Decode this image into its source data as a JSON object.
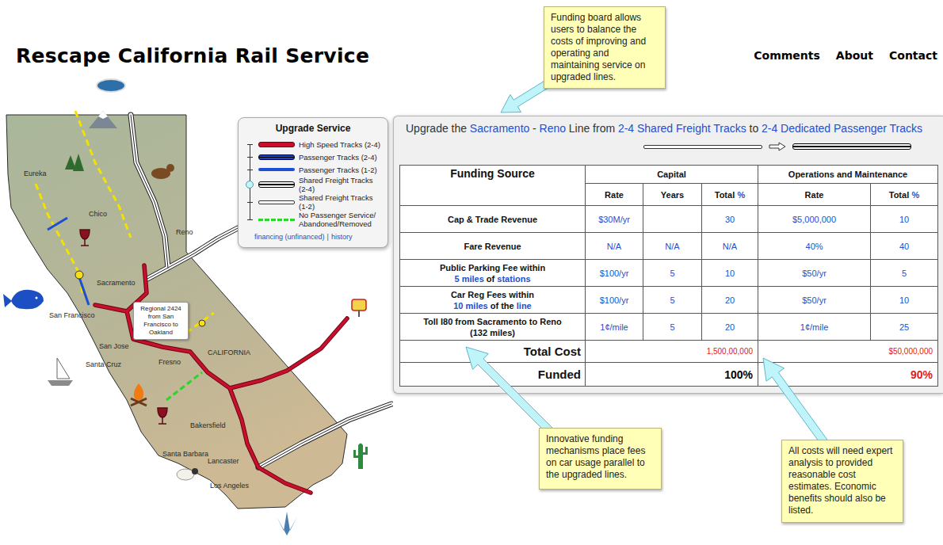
{
  "header": {
    "title": "Rescape California Rail Service",
    "nav": [
      "Comments",
      "About",
      "Contact"
    ]
  },
  "map": {
    "labels": [
      "Eureka",
      "Chico",
      "Reno",
      "Sacramento",
      "San Francisco",
      "San Jose",
      "Santa Cruz",
      "Fresno",
      "CALIFORNIA",
      "Bakersfield",
      "Lancaster",
      "Santa Barbara",
      "Los Angeles"
    ],
    "tooltip": "Regional 2424 from San Francisco to Oakland"
  },
  "legend": {
    "title": "Upgrade Service",
    "items": [
      {
        "label": "High Speed Tracks (2-4)",
        "kind": "high-speed",
        "selected": false
      },
      {
        "label": "Passenger Tracks (2-4)",
        "kind": "passenger-double",
        "selected": false
      },
      {
        "label": "Passenger Tracks (1-2)",
        "kind": "passenger-single",
        "selected": false
      },
      {
        "label": "Shared Freight Tracks (2-4)",
        "kind": "freight-double",
        "selected": true
      },
      {
        "label": "Shared Freight Tracks (1-2)",
        "kind": "freight-single",
        "selected": false
      },
      {
        "label": "No Passenger Service/ Abandoned/Removed",
        "kind": "none",
        "selected": false
      }
    ],
    "links": [
      "financing (unfinanced)",
      "history"
    ],
    "separator": "|"
  },
  "board": {
    "heading": [
      {
        "text": "Upgrade the",
        "link": false
      },
      {
        "text": "Sacramento",
        "link": true
      },
      {
        "text": "-",
        "link": false
      },
      {
        "text": "Reno",
        "link": true
      },
      {
        "text": "Line from",
        "link": false
      },
      {
        "text": "2-4 Shared Freight Tracks",
        "link": true
      },
      {
        "text": "to",
        "link": false
      },
      {
        "text": "2-4 Dedicated Passenger Tracks",
        "link": true
      }
    ],
    "transition": {
      "from": "freight-single",
      "to": "freight-double"
    },
    "table": {
      "source_header": "Funding Source",
      "groups": [
        {
          "label": "Capital",
          "columns": [
            {
              "label": "Rate",
              "unit": ""
            },
            {
              "label": "Years",
              "unit": ""
            },
            {
              "label": "Total",
              "unit": "%"
            }
          ]
        },
        {
          "label": "Operations and Maintenance",
          "columns": [
            {
              "label": "Rate",
              "unit": ""
            },
            {
              "label": "Total",
              "unit": "%"
            }
          ]
        }
      ],
      "rows": [
        {
          "source": [
            [
              {
                "text": "Cap & Trade Revenue",
                "link": false
              }
            ]
          ],
          "cells": [
            "$30M/yr",
            "",
            "30",
            "$5,000,000",
            "10"
          ]
        },
        {
          "source": [
            [
              {
                "text": "Fare Revenue",
                "link": false
              }
            ]
          ],
          "cells": [
            "N/A",
            "N/A",
            "N/A",
            "40%",
            "40"
          ]
        },
        {
          "source": [
            [
              {
                "text": "Public Parking Fee within",
                "link": false
              }
            ],
            [
              {
                "text": "5 miles",
                "link": true
              },
              {
                "text": "of",
                "link": false
              },
              {
                "text": "stations",
                "link": true
              }
            ]
          ],
          "cells": [
            "$100/yr",
            "5",
            "10",
            "$50/yr",
            "5"
          ]
        },
        {
          "source": [
            [
              {
                "text": "Car Reg Fees within",
                "link": false
              }
            ],
            [
              {
                "text": "10 miles",
                "link": true
              },
              {
                "text": "of the",
                "link": false
              },
              {
                "text": "line",
                "link": true
              }
            ]
          ],
          "cells": [
            "$100/yr",
            "5",
            "20",
            "$50/yr",
            "10"
          ]
        },
        {
          "source": [
            [
              {
                "text": "Toll I80 from Sacramento to Reno",
                "link": false
              }
            ],
            [
              {
                "text": "(132 miles)",
                "link": false
              }
            ]
          ],
          "cells": [
            "1¢/mile",
            "5",
            "20",
            "1¢/mile",
            "25"
          ]
        }
      ],
      "totals": [
        {
          "label": "Total Cost",
          "values": [
            {
              "text": "1,500,00,000",
              "color": "#e02020"
            },
            {
              "text": "$50,000,000",
              "color": "#e02020"
            }
          ]
        },
        {
          "label": "Funded",
          "values": [
            {
              "text": "100%",
              "color": "#000000"
            },
            {
              "text": "90%",
              "color": "#e02020"
            }
          ]
        }
      ]
    }
  },
  "notes": [
    "Funding board allows users to balance the costs of improving and operating and maintaining service on upgraded lines.",
    "Innovative funding mechanisms place fees on car usage parallel to the upgraded lines.",
    "All costs will need expert analysis to provided reasonable cost estimates. Economic benefits should also be listed."
  ]
}
